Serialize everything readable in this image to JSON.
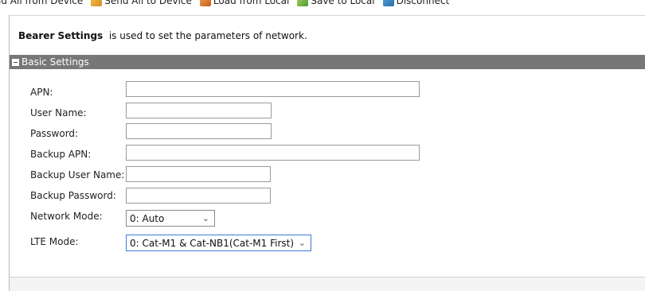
{
  "toolbar": {
    "items": [
      {
        "label": "ad All from Device",
        "icon": "read-device-icon"
      },
      {
        "label": "Send All to Device",
        "icon": "send-device-icon"
      },
      {
        "label": "Load from Local",
        "icon": "load-local-icon"
      },
      {
        "label": "Save to Local",
        "icon": "save-local-icon"
      },
      {
        "label": "Disconnect",
        "icon": "disconnect-icon"
      }
    ]
  },
  "intro": {
    "title": "Bearer Settings",
    "text": "  is used to set the parameters of network."
  },
  "section": {
    "title": "Basic Settings"
  },
  "form": {
    "apn": {
      "label": "APN:",
      "value": ""
    },
    "user_name": {
      "label": "User Name:",
      "value": ""
    },
    "password": {
      "label": "Password:",
      "value": ""
    },
    "backup_apn": {
      "label": "Backup APN:",
      "value": ""
    },
    "backup_user_name": {
      "label": "Backup User Name:",
      "value": ""
    },
    "backup_password": {
      "label": "Backup Password:",
      "value": ""
    },
    "network_mode": {
      "label": "Network Mode:",
      "selected": "0: Auto"
    },
    "lte_mode": {
      "label": "LTE Mode:",
      "selected": "0: Cat-M1 & Cat-NB1(Cat-M1 First)"
    }
  },
  "colors": {
    "section_header_bg": "#777777",
    "focus_border": "#3b7bd4"
  }
}
